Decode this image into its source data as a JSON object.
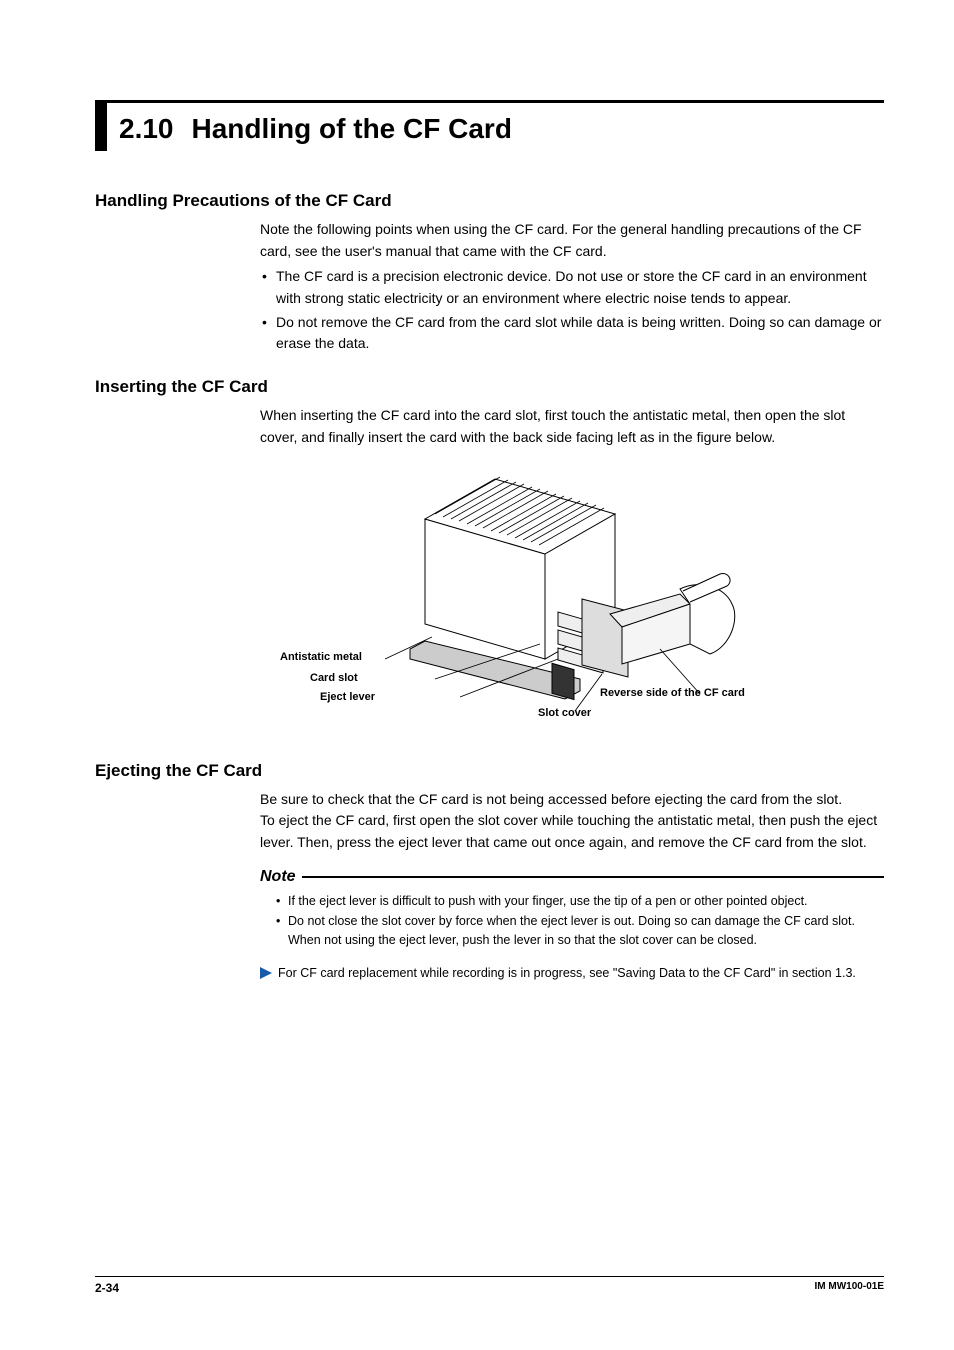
{
  "title": {
    "number": "2.10",
    "text": "Handling of the CF Card"
  },
  "sections": {
    "precautions": {
      "heading": "Handling Precautions of the CF Card",
      "intro": "Note the following points when using the CF card. For the general handling precautions of the CF card, see the user's manual that came with the CF card.",
      "bullets": [
        "The CF card is a precision electronic device. Do not use or store the CF card in an environment with strong static electricity or an environment where electric noise tends to appear.",
        "Do not remove the CF card from the card slot while data is being written. Doing so can damage or erase the data."
      ]
    },
    "inserting": {
      "heading": "Inserting the CF Card",
      "body": "When inserting the CF card into the card slot, first touch the antistatic metal, then open the slot cover, and finally insert the card with the back side facing left as in the figure below.",
      "figure_labels": {
        "antistatic_metal": "Antistatic metal",
        "card_slot": "Card slot",
        "eject_lever": "Eject lever",
        "reverse_side": "Reverse side of the CF card",
        "slot_cover": "Slot cover"
      }
    },
    "ejecting": {
      "heading": "Ejecting the CF Card",
      "body1": "Be sure to check that the CF card is not being accessed before ejecting the card from the slot.",
      "body2": "To eject the CF card, first open the slot cover while touching the antistatic metal, then push the eject lever. Then, press the eject lever that came out once again, and remove the CF card from the slot.",
      "note_heading": "Note",
      "note_bullets": [
        "If the eject lever is difficult to push with your finger, use the tip of a pen or other pointed object.",
        "Do not close the slot cover by force when the eject lever is out. Doing so can damage the CF card slot. When not using the eject lever, push the lever in so that the slot cover can be closed."
      ],
      "xref": "For CF card replacement while recording is in progress, see \"Saving Data to the CF Card\" in section 1.3."
    }
  },
  "footer": {
    "page": "2-34",
    "doc_id": "IM MW100-01E"
  }
}
